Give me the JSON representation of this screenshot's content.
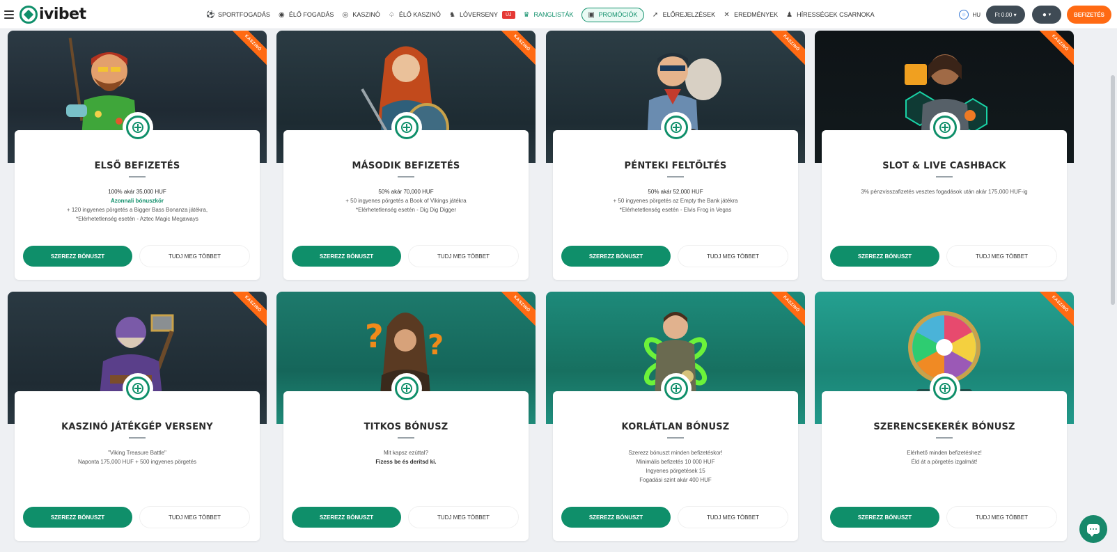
{
  "header": {
    "logo_text": "ivibet",
    "nav": [
      {
        "label": "SPORTFOGADÁS",
        "icon": "soccer-ball-icon"
      },
      {
        "label": "ÉLŐ FOGADÁS",
        "icon": "live-icon"
      },
      {
        "label": "KASZINÓ",
        "icon": "casino-chip-icon"
      },
      {
        "label": "ÉLŐ KASZINÓ",
        "icon": "live-casino-icon"
      },
      {
        "label": "LÓVERSENY",
        "icon": "horse-icon",
        "badge": "ÚJ"
      },
      {
        "label": "RANGLISTÁK",
        "icon": "trophy-icon"
      },
      {
        "label": "PROMÓCIÓK",
        "icon": "gift-icon"
      },
      {
        "label": "ELŐREJELZÉSEK",
        "icon": "cursor-icon"
      },
      {
        "label": "EREDMÉNYEK",
        "icon": "results-icon"
      },
      {
        "label": "HÍRESSÉGEK CSARNOKA",
        "icon": "people-icon"
      }
    ],
    "lang": "HU",
    "balance": "Ft 0.00",
    "deposit": "BEFIZETÉS"
  },
  "colors": {
    "brand_green": "#0f8f6a",
    "accent_orange": "#ff6a13"
  },
  "ribbon_label": "KASZINÓ",
  "cards": [
    {
      "title": "ELSŐ BEFIZETÉS",
      "desc": [
        "100% akár 35,000 HUF",
        "Azonnali bónuszkör",
        "+ 120 ingyenes pörgetés a Bigger Bass Bonanza játékra,",
        "*Elérhetetlenség esetén - Aztec Magic Megaways"
      ],
      "primary": "SZEREZZ BÓNUSZT",
      "secondary": "TUDJ MEG TÖBBET"
    },
    {
      "title": "MÁSODIK BEFIZETÉS",
      "desc": [
        "50% akár 70,000 HUF",
        "+ 50 ingyenes pörgetés a Book of Vikings játékra",
        "*Elérhetetlenség esetén - Dig Dig Digger"
      ],
      "primary": "SZEREZZ BÓNUSZT",
      "secondary": "TUDJ MEG TÖBBET"
    },
    {
      "title": "PÉNTEKI FELTÖLTÉS",
      "desc": [
        "50% akár 52,000 HUF",
        "+ 50 ingyenes pörgetés az Empty the Bank játékra",
        "*Elérhetetlenség esetén - Elvis Frog in Vegas"
      ],
      "primary": "SZEREZZ BÓNUSZT",
      "secondary": "TUDJ MEG TÖBBET"
    },
    {
      "title": "SLOT & LIVE CASHBACK",
      "desc": [
        "3% pénzvisszafizetés vesztes fogadások után akár 175,000 HUF-ig"
      ],
      "primary": "SZEREZZ BÓNUSZT",
      "secondary": "TUDJ MEG TÖBBET"
    },
    {
      "title": "KASZINÓ JÁTÉKGÉP VERSENY",
      "desc": [
        "\"Viking Treasure Battle\"",
        "Naponta 175,000 HUF + 500 ingyenes pörgetés"
      ],
      "primary": "SZEREZZ BÓNUSZT",
      "secondary": "TUDJ MEG TÖBBET"
    },
    {
      "title": "TITKOS BÓNUSZ",
      "desc": [
        "Mit kapsz ezúttal?",
        "Fizess be és derítsd ki."
      ],
      "primary": "SZEREZZ BÓNUSZT",
      "secondary": "TUDJ MEG TÖBBET"
    },
    {
      "title": "KORLÁTLAN BÓNUSZ",
      "desc": [
        "Szerezz bónuszt minden befizetéskor!",
        "Minimális befizetés 10 000 HUF",
        "Ingyenes pörgetések 15",
        "Fogadási szint akár 400 HUF"
      ],
      "primary": "SZEREZZ BÓNUSZT",
      "secondary": "TUDJ MEG TÖBBET"
    },
    {
      "title": "SZERENCSEKERÉK BÓNUSZ",
      "desc": [
        "Elérhető minden befizetéshez!",
        "Éld át a pörgetés izgalmát!"
      ],
      "primary": "SZEREZZ BÓNUSZT",
      "secondary": "TUDJ MEG TÖBBET"
    }
  ]
}
